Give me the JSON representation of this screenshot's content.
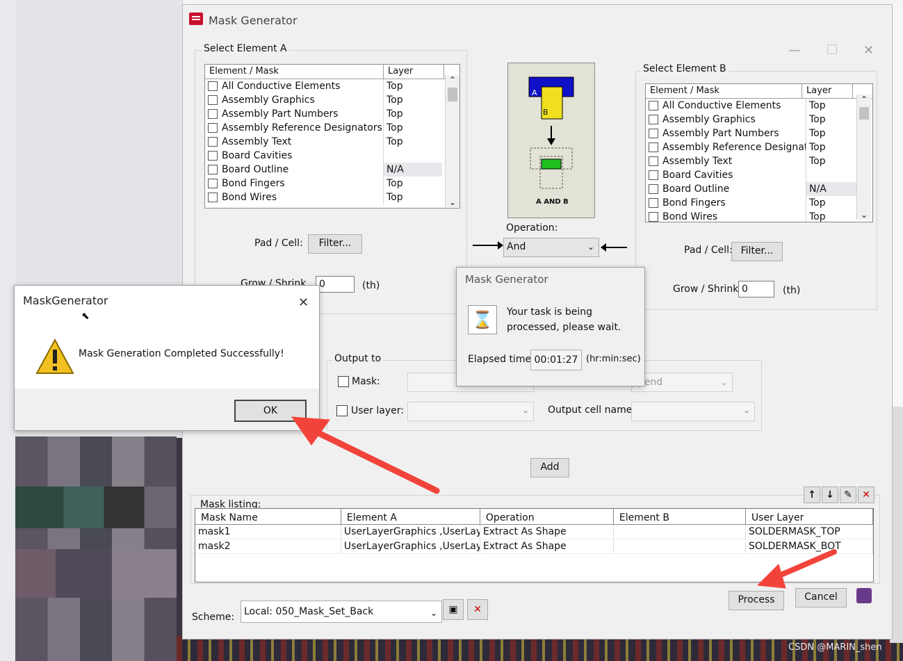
{
  "window": {
    "title": "Mask Generator"
  },
  "element_a": {
    "group_label": "Select Element A",
    "col_element": "Element / Mask",
    "col_layer": "Layer",
    "rows": [
      {
        "name": "All Conductive Elements",
        "layer": "Top"
      },
      {
        "name": "Assembly Graphics",
        "layer": "Top"
      },
      {
        "name": "Assembly Part Numbers",
        "layer": "Top"
      },
      {
        "name": "Assembly Reference Designators",
        "layer": "Top"
      },
      {
        "name": "Assembly Text",
        "layer": "Top"
      },
      {
        "name": "Board Cavities",
        "layer": ""
      },
      {
        "name": "Board Outline",
        "layer": "N/A"
      },
      {
        "name": "Bond Fingers",
        "layer": "Top"
      },
      {
        "name": "Bond Wires",
        "layer": "Top"
      }
    ],
    "pad_cell_label": "Pad / Cell:",
    "filter_label": "Filter...",
    "grow_label": "Grow / Shrink",
    "grow_value": "0",
    "grow_unit": "(th)"
  },
  "element_b": {
    "group_label": "Select Element B",
    "col_element": "Element / Mask",
    "col_layer": "Layer",
    "rows": [
      {
        "name": "All Conductive Elements",
        "layer": "Top"
      },
      {
        "name": "Assembly Graphics",
        "layer": "Top"
      },
      {
        "name": "Assembly Part Numbers",
        "layer": "Top"
      },
      {
        "name": "Assembly Reference Designators",
        "layer": "Top"
      },
      {
        "name": "Assembly Text",
        "layer": "Top"
      },
      {
        "name": "Board Cavities",
        "layer": ""
      },
      {
        "name": "Board Outline",
        "layer": "N/A"
      },
      {
        "name": "Bond Fingers",
        "layer": "Top"
      },
      {
        "name": "Bond Wires",
        "layer": "Top"
      }
    ],
    "pad_cell_label": "Pad / Cell:",
    "filter_label": "Filter...",
    "grow_label": "Grow / Shrink",
    "grow_value": "0",
    "grow_unit": "(th)"
  },
  "operation": {
    "label_a": "A",
    "label_b": "B",
    "caption": "A AND B",
    "op_label": "Operation:",
    "selected": "And"
  },
  "output": {
    "group_label": "Output to",
    "mask_label": "Mask:",
    "user_layer_label": "User layer:",
    "output_mode_value": "ppend",
    "output_cell_label": "Output cell name:",
    "add_label": "Add"
  },
  "mask_listing": {
    "label": "Mask listing:",
    "columns": [
      "Mask Name",
      "Element A",
      "Operation",
      "Element B",
      "User Layer"
    ],
    "rows": [
      [
        "mask1",
        "UserLayerGraphics ,UserLay...",
        "Extract As Shape",
        "",
        "SOLDERMASK_TOP"
      ],
      [
        "mask2",
        "UserLayerGraphics ,UserLay...",
        "Extract As Shape",
        "",
        "SOLDERMASK_BOT"
      ]
    ]
  },
  "bottom": {
    "scheme_label": "Scheme:",
    "scheme_value": "Local: 050_Mask_Set_Back",
    "process_label": "Process",
    "cancel_label": "Cancel"
  },
  "progress_dialog": {
    "title": "Mask Generator",
    "message_line1": "Your task is being",
    "message_line2": "processed, please wait.",
    "elapsed_label": "Elapsed time:",
    "elapsed_value": "00:01:27",
    "elapsed_unit": "(hr:min:sec)"
  },
  "success_dialog": {
    "title": "MaskGenerator",
    "message": "Mask Generation Completed Successfully!",
    "ok_label": "OK"
  },
  "watermark": "CSDN @MARIN_shen",
  "colors": {
    "arrow": "#f2433a",
    "mask_blue": "#1010c8",
    "mask_yellow": "#f0e020",
    "result_green": "#20c020"
  }
}
